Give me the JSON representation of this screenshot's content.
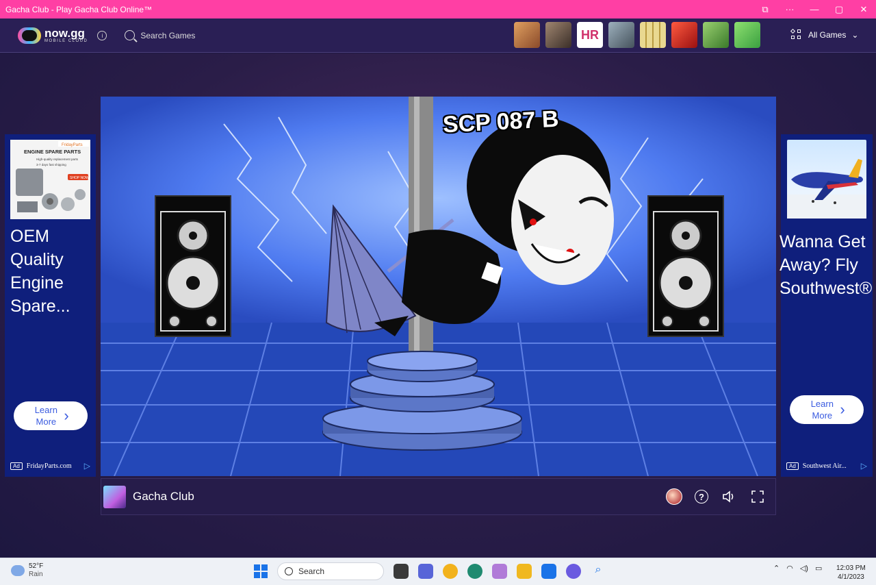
{
  "window": {
    "title": "Gacha Club - Play Gacha Club Online™",
    "controls": [
      "⧉",
      "···",
      "—",
      "▢",
      "✕"
    ]
  },
  "header": {
    "logo_main": "now.gg",
    "logo_sub": "MOBILE CLOUD",
    "search_label": "Search Games",
    "all_games_label": "All Games",
    "thumb_colors": [
      "#c97a3a",
      "#6b5a48",
      "#ffffff",
      "#6d7f8c",
      "#c8b060",
      "#d8302a",
      "#5aa03a",
      "#6cc24a"
    ]
  },
  "ad_left": {
    "image_brand": "FridayParts",
    "image_title": "ENGINE SPARE PARTS",
    "image_sub": "High-quality replacement parts",
    "image_sub2": "3-7 days fast shipping",
    "image_button": "SHOP NOW",
    "headline": "OEM Quality Engine Spare...",
    "cta": "Learn More",
    "badge": "Ad",
    "advertiser": "FridayParts.com"
  },
  "ad_right": {
    "headline": "Wanna Get Away? Fly Southwest®",
    "cta": "Learn More",
    "badge": "Ad",
    "advertiser": "Southwest Air..."
  },
  "game": {
    "scene_title": "SCP 087 B",
    "name": "Gacha Club"
  },
  "taskbar": {
    "temperature": "52°F",
    "condition": "Rain",
    "search_label": "Search",
    "time": "12:03 PM",
    "date": "4/1/2023",
    "app_colors": [
      "#3a3a3a",
      "#5865d8",
      "#f2b21c",
      "#1f8a70",
      "#b07ad8",
      "#f0b820",
      "#1a73e8",
      "#6a5ae0",
      "#1a73e8"
    ]
  },
  "colors": {
    "titlebar": "#ff3fa4",
    "header_bg": "#2a1f55",
    "ad_bg": "#0f1f7c",
    "cta_text": "#3a5be0"
  }
}
